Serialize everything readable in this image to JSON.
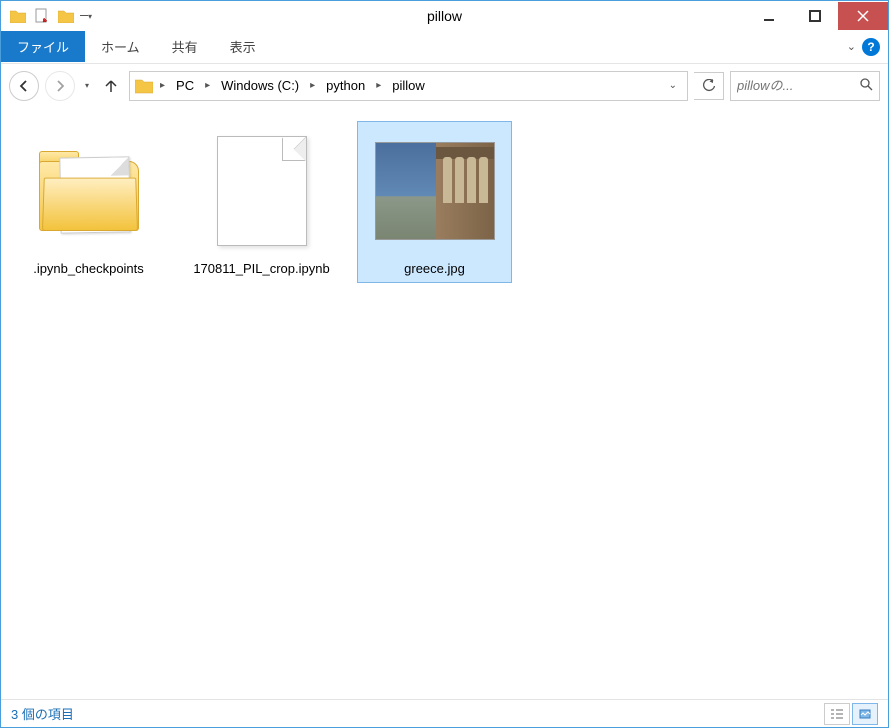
{
  "window": {
    "title": "pillow"
  },
  "ribbon": {
    "file": "ファイル",
    "home": "ホーム",
    "share": "共有",
    "view": "表示"
  },
  "breadcrumb": {
    "parts": [
      "PC",
      "Windows (C:)",
      "python",
      "pillow"
    ]
  },
  "search": {
    "placeholder": "pillowの..."
  },
  "items": [
    {
      "name": ".ipynb_checkpoints",
      "type": "folder",
      "selected": false
    },
    {
      "name": "170811_PIL_crop.ipynb",
      "type": "file",
      "selected": false
    },
    {
      "name": "greece.jpg",
      "type": "image",
      "selected": true
    }
  ],
  "status": {
    "text": "3 個の項目"
  }
}
